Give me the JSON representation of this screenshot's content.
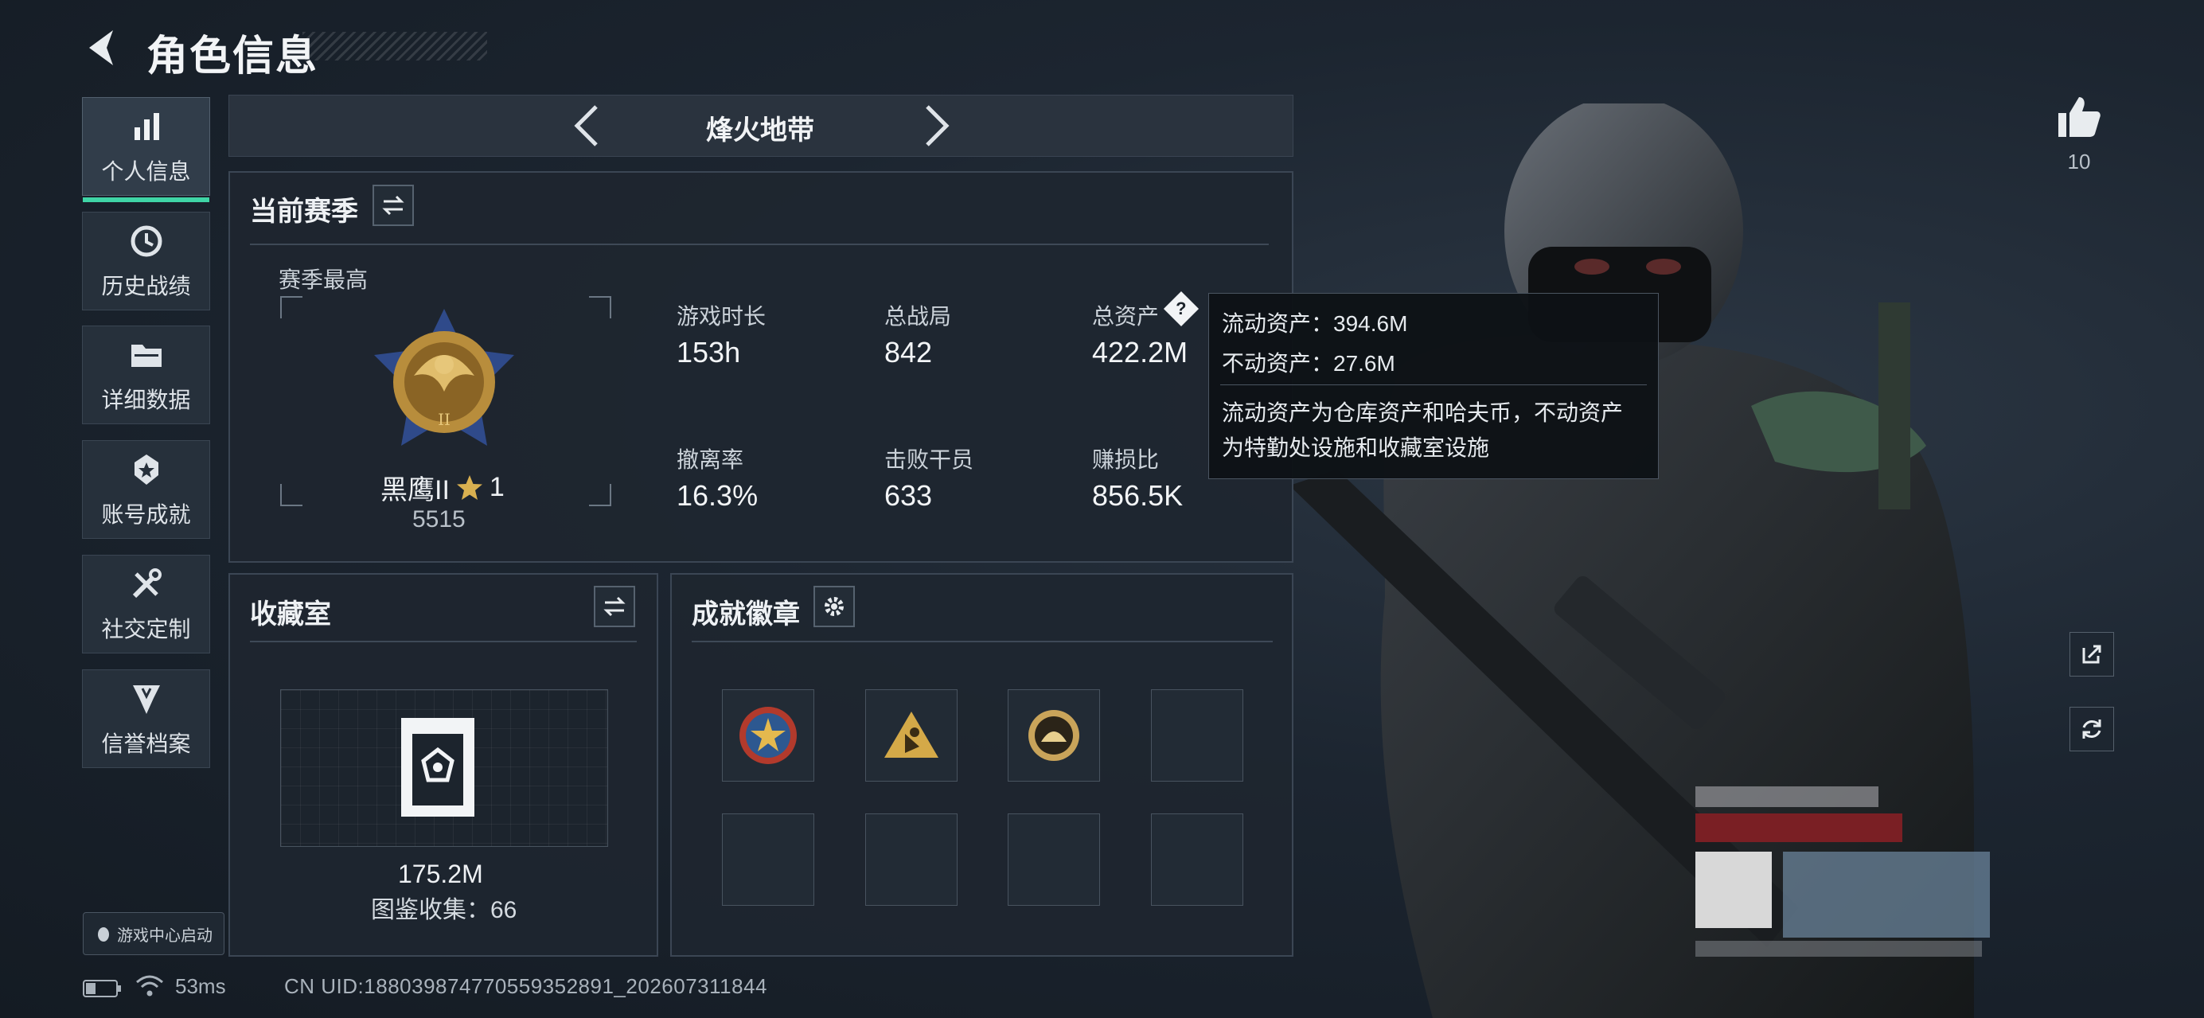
{
  "header": {
    "title": "角色信息",
    "back_icon": "back-arrow-icon"
  },
  "sidebar": {
    "items": [
      {
        "label": "个人信息",
        "icon": "bar-chart-icon",
        "active": true
      },
      {
        "label": "历史战绩",
        "icon": "history-clock-icon",
        "active": false
      },
      {
        "label": "详细数据",
        "icon": "folder-icon",
        "active": false
      },
      {
        "label": "账号成就",
        "icon": "medal-icon",
        "active": false
      },
      {
        "label": "社交定制",
        "icon": "tools-icon",
        "active": false
      },
      {
        "label": "信誉档案",
        "icon": "shield-icon",
        "active": false
      }
    ],
    "launch_badge": "游戏中心启动"
  },
  "mode_selector": {
    "name": "烽火地带"
  },
  "season_panel": {
    "title": "当前赛季",
    "subtitle": "赛季最高",
    "rank_name": "黑鹰II",
    "rank_stars": "1",
    "rank_points": "5515",
    "stats": [
      {
        "label": "游戏时长",
        "value": "153h"
      },
      {
        "label": "总战局",
        "value": "842"
      },
      {
        "label": "总资产",
        "value": "422.2M"
      },
      {
        "label": "撤离率",
        "value": "16.3%"
      },
      {
        "label": "击败干员",
        "value": "633"
      },
      {
        "label": "赚损比",
        "value": "856.5K"
      }
    ]
  },
  "tooltip": {
    "line1": "流动资产：394.6M",
    "line2": "不动资产：27.6M",
    "desc1": "流动资产为仓库资产和哈夫币，不动资产",
    "desc2": "为特勤处设施和收藏室设施"
  },
  "collection_panel": {
    "title": "收藏室",
    "value": "175.2M",
    "catalog": "图鉴收集：66"
  },
  "badges_panel": {
    "title": "成就徽章"
  },
  "right": {
    "like_count": "10"
  },
  "footer": {
    "ping": "53ms",
    "uid": "CN UID:18803987477055935289​1_202607311844"
  },
  "colors": {
    "accent": "#3fd5a6",
    "gold": "#c9a24a",
    "panel_border": "#3b4654"
  }
}
